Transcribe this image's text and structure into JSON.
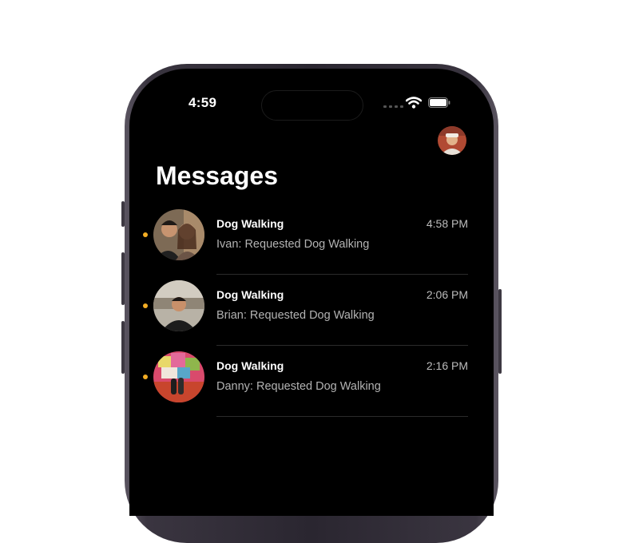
{
  "status_bar": {
    "time": "4:59"
  },
  "header": {
    "title": "Messages"
  },
  "conversations": [
    {
      "title": "Dog Walking",
      "time": "4:58 PM",
      "preview": "Ivan: Requested Dog Walking",
      "unread": true
    },
    {
      "title": "Dog Walking",
      "time": "2:06 PM",
      "preview": "Brian: Requested Dog Walking",
      "unread": true
    },
    {
      "title": "Dog Walking",
      "time": "2:16 PM",
      "preview": "Danny: Requested Dog Walking",
      "unread": true
    }
  ],
  "colors": {
    "unread_dot": "#f3ad24",
    "background": "#000000",
    "primary_text": "#ffffff",
    "secondary_text": "#b3b3b3"
  }
}
